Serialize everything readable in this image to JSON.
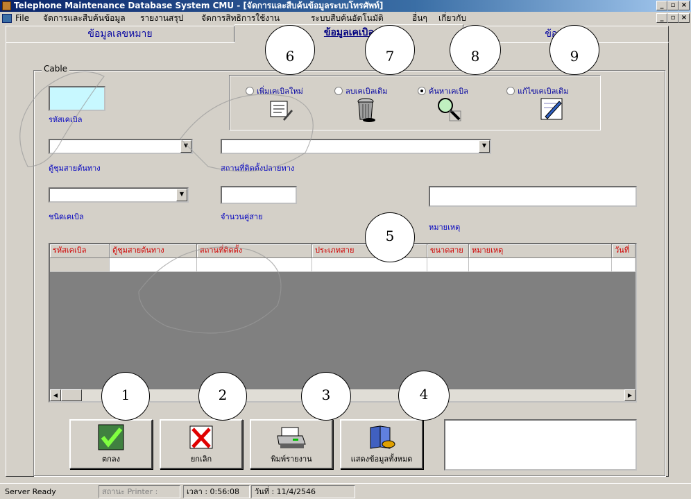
{
  "window": {
    "title": "Telephone Maintenance Database System CMU - [จัดการและสืบค้นข้อมูลระบบโทรศัพท์]",
    "minimize": "_",
    "maximize": "▫",
    "close": "×"
  },
  "menu": {
    "items": [
      "File",
      "จัดการและสืบค้นข้อมูล",
      "รายงานสรุป",
      "จัดการสิทธิการใช้งาน",
      "ระบบสืบค้นอัตโนมัติ",
      "อื่นๆ",
      "เกี่ยวกับ"
    ]
  },
  "tabs": [
    {
      "label": "ข้อมูลเลขหมาย"
    },
    {
      "label": "ข้อมูลเคเบิล"
    },
    {
      "label": "ข้อมูลอื่นๆ"
    }
  ],
  "form": {
    "group_title": "Cable",
    "cable_code_label": "รหัสเคเบิล",
    "origin_cabinet_label": "ตู้ชุมสายต้นทาง",
    "destination_label": "สถานที่ติดตั้งปลายทาง",
    "cable_type_label": "ชนิดเคเบิล",
    "pair_count_label": "จำนวนคู่สาย",
    "remark_label": "หมายเหตุ"
  },
  "radios": [
    {
      "label": "เพิ่มเคเบิลใหม่",
      "icon": "document-icon",
      "checked": false
    },
    {
      "label": "ลบเคเบิลเดิม",
      "icon": "trash-icon",
      "checked": false
    },
    {
      "label": "ค้นหาเคเบิล",
      "icon": "magnifier-icon",
      "checked": true
    },
    {
      "label": "แก้ไขเคเบิลเดิม",
      "icon": "edit-icon",
      "checked": false
    }
  ],
  "grid": {
    "columns": [
      "รหัสเคเบิล",
      "ตู้ชุมสายต้นทาง",
      "สถานที่ติดตั้ง",
      "ประเภทสาย",
      "ขนาดสาย",
      "หมายเหตุ",
      "วันที่"
    ]
  },
  "buttons": {
    "ok": "ตกลง",
    "cancel": "ยกเลิก",
    "print": "พิมพ์รายงาน",
    "show_all": "แสดงข้อมูลทั้งหมด"
  },
  "status": {
    "server": "Server Ready",
    "printer": "สถานะ Printer :",
    "time": "เวลา : 0:56:08",
    "date": "วันที่ : 11/4/2546"
  },
  "callouts": [
    "1",
    "2",
    "3",
    "4",
    "5",
    "6",
    "7",
    "8",
    "9"
  ],
  "colors": {
    "title_bar": "#0a246a",
    "cable_code_box": "#c8f8ff",
    "label_blue": "#0000c0",
    "grid_header_text": "#d00000"
  }
}
